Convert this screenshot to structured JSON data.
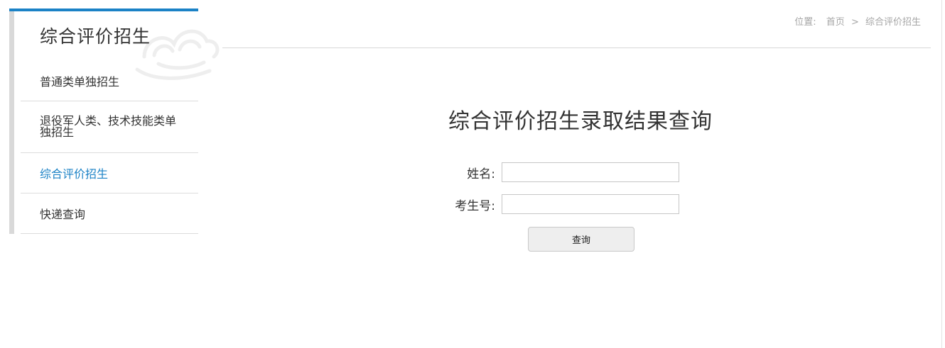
{
  "sidebar": {
    "title": "综合评价招生",
    "items": [
      {
        "label": "普通类单独招生"
      },
      {
        "label": "退役军人类、技术技能类单独招生"
      },
      {
        "label": "综合评价招生",
        "active": true
      },
      {
        "label": "快递查询"
      }
    ],
    "decoration_icon": "cloud-pattern-icon"
  },
  "breadcrumb": {
    "prefix": "位置:",
    "home": "首页",
    "separator": ">",
    "current": "综合评价招生"
  },
  "main": {
    "title": "综合评价招生录取结果查询",
    "form": {
      "name_label": "姓名:",
      "name_value": "",
      "exam_label": "考生号:",
      "exam_value": "",
      "submit_label": "查询"
    }
  },
  "colors": {
    "accent": "#1b82c6",
    "text": "#333333",
    "muted": "#a6a6a6",
    "divider": "#dcdcdc"
  }
}
